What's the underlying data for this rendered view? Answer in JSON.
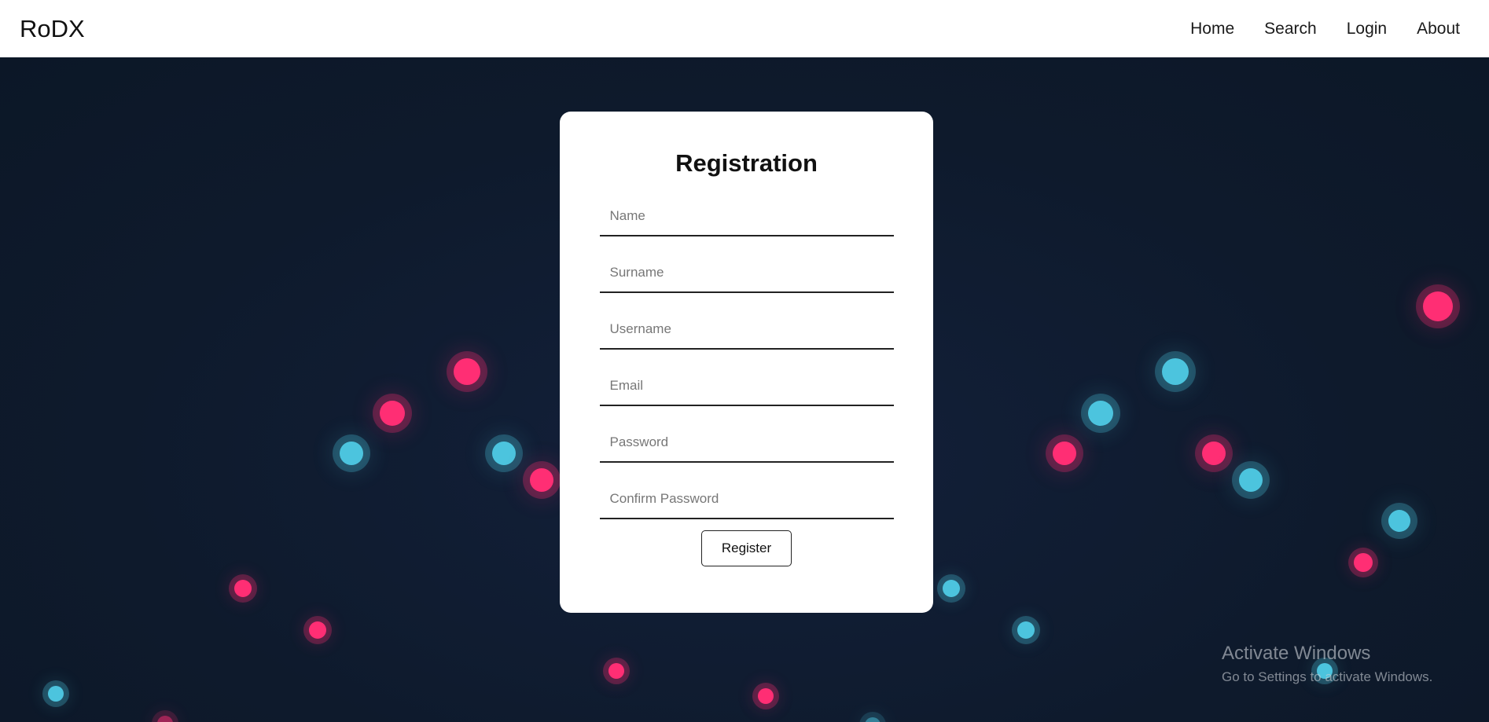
{
  "navbar": {
    "brand": "RoDX",
    "links": [
      {
        "label": "Home"
      },
      {
        "label": "Search"
      },
      {
        "label": "Login"
      },
      {
        "label": "About"
      }
    ]
  },
  "form": {
    "title": "Registration",
    "fields": [
      {
        "placeholder": "Name",
        "value": ""
      },
      {
        "placeholder": "Surname",
        "value": ""
      },
      {
        "placeholder": "Username",
        "value": ""
      },
      {
        "placeholder": "Email",
        "value": ""
      },
      {
        "placeholder": "Password",
        "value": ""
      },
      {
        "placeholder": "Confirm Password",
        "value": ""
      }
    ],
    "submit_label": "Register"
  },
  "watermark": {
    "title": "Activate Windows",
    "subtitle": "Go to Settings to activate Windows."
  },
  "colors": {
    "background": "#0e1a2c",
    "dot_pink": "#ff2e74",
    "dot_blue": "#4cc4de"
  }
}
